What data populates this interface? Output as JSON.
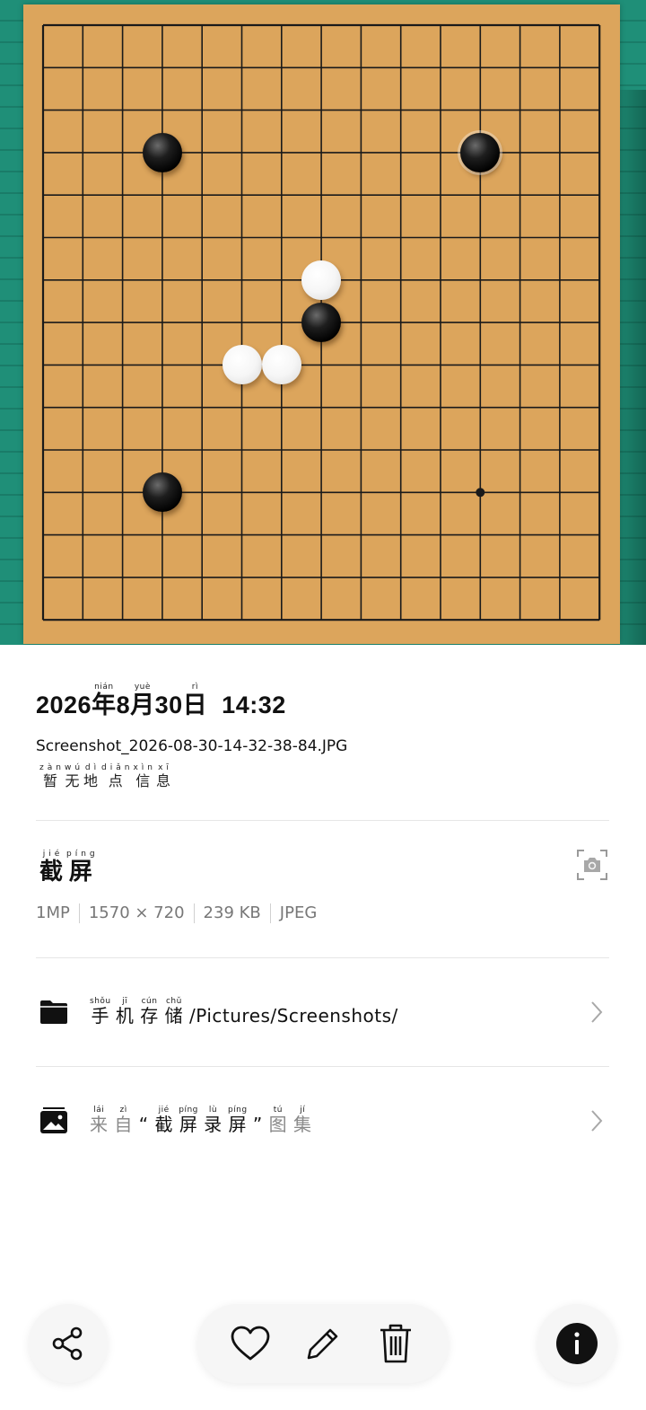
{
  "image": {
    "board": {
      "size": 15,
      "colors": {
        "board": "#dca55c",
        "background": "#1f8f78",
        "line": "#1a1a1a"
      },
      "stones": [
        {
          "color": "black",
          "col": 3,
          "row": 3
        },
        {
          "color": "black",
          "col": 11,
          "row": 3,
          "last_move": true
        },
        {
          "color": "white",
          "col": 7,
          "row": 6
        },
        {
          "color": "black",
          "col": 7,
          "row": 7
        },
        {
          "color": "white",
          "col": 5,
          "row": 8
        },
        {
          "color": "white",
          "col": 6,
          "row": 8
        },
        {
          "color": "black",
          "col": 3,
          "row": 11
        }
      ],
      "star_points": [
        {
          "col": 11,
          "row": 11
        }
      ]
    }
  },
  "info": {
    "date": {
      "year": "2026",
      "nian": "年",
      "nian_py": "nián",
      "month": "8",
      "yue": "月",
      "yue_py": "yuè",
      "day": "30",
      "ri": "日",
      "ri_py": "rì",
      "time": "14:32"
    },
    "filename": "Screenshot_2026-08-30-14-32-38-84.JPG",
    "location": [
      {
        "char": "暂",
        "py": "zàn"
      },
      {
        "char": "无",
        "py": "wú"
      },
      {
        "char": "地",
        "py": "dì"
      },
      {
        "char": "点",
        "py": "diǎn"
      },
      {
        "char": "信",
        "py": "xìn"
      },
      {
        "char": "息",
        "py": "xī"
      }
    ],
    "type_title": [
      {
        "char": "截",
        "py": "jié"
      },
      {
        "char": "屏",
        "py": "píng"
      }
    ],
    "specs": [
      "1MP",
      "1570 × 720",
      "239 KB",
      "JPEG"
    ],
    "camera_icon": "camera-icon",
    "path": {
      "icon": "folder-icon",
      "prefix": [
        {
          "char": "手",
          "py": "shǒu"
        },
        {
          "char": "机",
          "py": "jī"
        },
        {
          "char": "存",
          "py": "cún"
        },
        {
          "char": "储",
          "py": "chǔ"
        }
      ],
      "path_text": "/Pictures/Screenshots/"
    },
    "album": {
      "icon": "album-icon",
      "parts": [
        {
          "char": "来",
          "py": "lái",
          "tone": "grey"
        },
        {
          "char": "自",
          "py": "zì",
          "tone": "grey"
        },
        {
          "char": "“",
          "py": "",
          "tone": "dark"
        },
        {
          "char": "截",
          "py": "jié",
          "tone": "dark"
        },
        {
          "char": "屏",
          "py": "píng",
          "tone": "dark"
        },
        {
          "char": "录",
          "py": "lù",
          "tone": "dark"
        },
        {
          "char": "屏",
          "py": "píng",
          "tone": "dark"
        },
        {
          "char": "”",
          "py": "",
          "tone": "dark"
        },
        {
          "char": "图",
          "py": "tú",
          "tone": "grey"
        },
        {
          "char": "集",
          "py": "jí",
          "tone": "grey"
        }
      ]
    }
  },
  "toolbar": {
    "share_icon": "share-icon",
    "favorite_icon": "heart-icon",
    "edit_icon": "pencil-icon",
    "delete_icon": "trash-icon",
    "info_icon": "info-icon"
  }
}
